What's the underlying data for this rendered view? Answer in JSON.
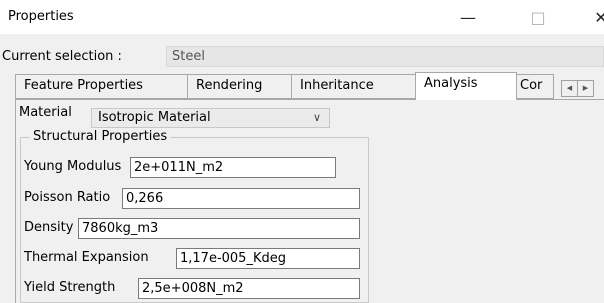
{
  "window": {
    "title": "Properties",
    "minimize_glyph": "—",
    "maximize_glyph": "□",
    "close_glyph": "✕"
  },
  "current_selection": {
    "label": "Current selection :",
    "value": "Steel"
  },
  "tabs": [
    {
      "label": "Feature Properties",
      "active": false
    },
    {
      "label": "Rendering",
      "active": false
    },
    {
      "label": "Inheritance",
      "active": false
    },
    {
      "label": "Analysis",
      "active": true
    },
    {
      "label": "Cor",
      "active": false
    }
  ],
  "tab_scroll": {
    "left": "◀",
    "right": "▶"
  },
  "material": {
    "label": "Material",
    "selected": "Isotropic Material",
    "chevron": "∨"
  },
  "structural": {
    "legend": "Structural Properties",
    "fields": [
      {
        "label": "Young Modulus",
        "value": "2e+011N_m2"
      },
      {
        "label": "Poisson Ratio",
        "value": "0,266"
      },
      {
        "label": "Density",
        "value": "7860kg_m3"
      },
      {
        "label": "Thermal Expansion",
        "value": "1,17e-005_Kdeg"
      },
      {
        "label": "Yield Strength",
        "value": "2,5e+008N_m2"
      }
    ]
  }
}
